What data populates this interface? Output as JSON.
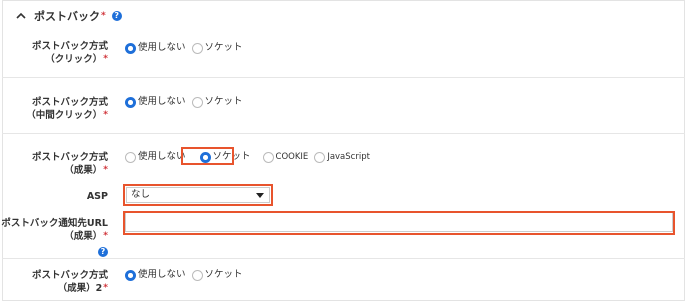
{
  "section": {
    "title": "ポストバック",
    "required_mark": "*",
    "help_icon": "?"
  },
  "rows": [
    {
      "label_line1": "ポストバック方式",
      "label_line2": "（クリック）",
      "required_mark": "*",
      "options": [
        {
          "label": "使用しない",
          "checked": true
        },
        {
          "label": "ソケット",
          "checked": false
        }
      ]
    },
    {
      "label_line1": "ポストバック方式",
      "label_line2": "（中間クリック）",
      "required_mark": "*",
      "options": [
        {
          "label": "使用しない",
          "checked": true
        },
        {
          "label": "ソケット",
          "checked": false
        }
      ]
    },
    {
      "label_line1": "ポストバック方式",
      "label_line2": "（成果）",
      "required_mark": "*",
      "options": [
        {
          "label": "使用しない",
          "checked": false
        },
        {
          "label": "ソケット",
          "checked": true
        },
        {
          "label": "COOKIE",
          "checked": false
        },
        {
          "label": "JavaScript",
          "checked": false
        }
      ]
    }
  ],
  "asp": {
    "label": "ASP",
    "selected": "なし"
  },
  "url_field": {
    "label_line1": "ポストバック通知先URL",
    "label_line2": "（成果）",
    "required_mark": "*",
    "help_icon": "?",
    "value": ""
  },
  "last_row": {
    "label_line1": "ポストバック方式",
    "label_line2": "（成果）2",
    "required_mark": "*",
    "options": [
      {
        "label": "使用しない",
        "checked": true
      },
      {
        "label": "ソケット",
        "checked": false
      }
    ]
  },
  "colors": {
    "accent": "#1e6fd9",
    "highlight": "#e8542d",
    "required": "#d0343a"
  }
}
